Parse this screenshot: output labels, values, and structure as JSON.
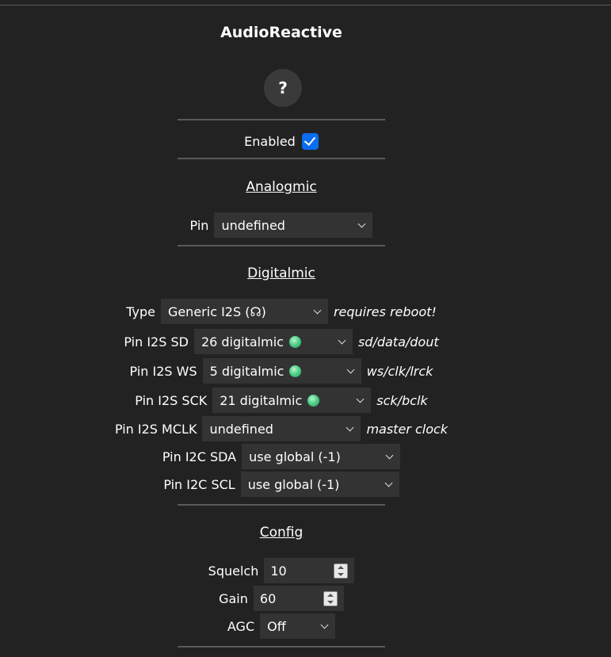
{
  "title": "AudioReactive",
  "help_label": "?",
  "enabled": {
    "label": "Enabled",
    "checked": true
  },
  "analogmic": {
    "heading": "Analogmic",
    "pin": {
      "label": "Pin",
      "value": "undefined"
    }
  },
  "digitalmic": {
    "heading": "Digitalmic",
    "type": {
      "label": "Type",
      "value": "Generic I2S (☊)",
      "hint": "requires reboot!"
    },
    "sd": {
      "label": "Pin I2S SD",
      "value": "26 digitalmic",
      "hint": "sd/data/dout"
    },
    "ws": {
      "label": "Pin I2S WS",
      "value": "5 digitalmic",
      "hint": "ws/clk/lrck"
    },
    "sck": {
      "label": "Pin I2S SCK",
      "value": "21 digitalmic",
      "hint": "sck/bclk"
    },
    "mclk": {
      "label": "Pin I2S MCLK",
      "value": "undefined",
      "hint": "master clock"
    },
    "sda": {
      "label": "Pin I2C SDA",
      "value": "use global (-1)"
    },
    "scl": {
      "label": "Pin I2C SCL",
      "value": "use global (-1)"
    }
  },
  "config": {
    "heading": "Config",
    "squelch": {
      "label": "Squelch",
      "value": "10"
    },
    "gain": {
      "label": "Gain",
      "value": "60"
    },
    "agc": {
      "label": "AGC",
      "value": "Off"
    }
  },
  "colors": {
    "background": "#222222",
    "field": "#333333",
    "checkbox": "#0a6cf0",
    "pin_ok": "#4fd08a"
  }
}
